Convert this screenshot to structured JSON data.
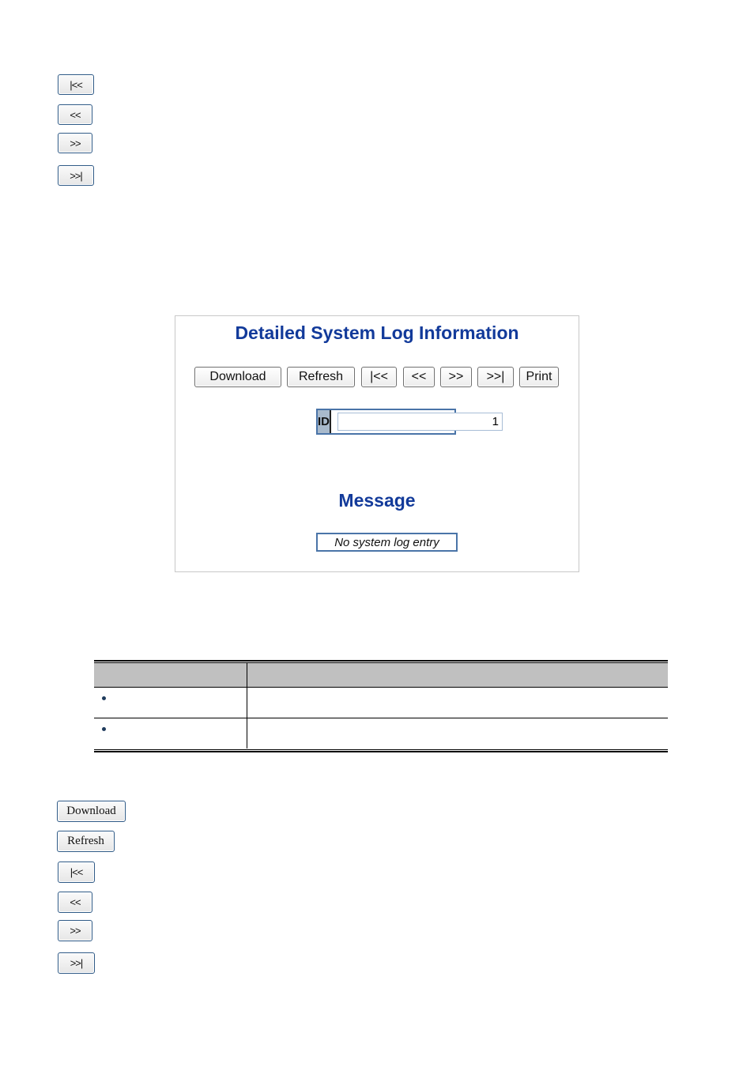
{
  "top_buttons": [
    {
      "label": "|<<",
      "name": "first-page-button"
    },
    {
      "label": "<<",
      "name": "previous-page-button"
    },
    {
      "label": ">>",
      "name": "next-page-button"
    },
    {
      "label": ">>|",
      "name": "last-page-button"
    }
  ],
  "panel": {
    "title": "Detailed System Log Information",
    "buttons": {
      "download": "Download",
      "refresh": "Refresh",
      "first": "|<<",
      "previous": "<<",
      "next": ">>",
      "last": ">>|",
      "print": "Print"
    },
    "id_label": "ID",
    "id_value": "1",
    "message_title": "Message",
    "message_text": "No system log entry"
  },
  "table": {
    "headers": [
      "",
      ""
    ],
    "rows": [
      {
        "bullet": "•",
        "object": "",
        "description": ""
      },
      {
        "bullet": "•",
        "object": "",
        "description": ""
      }
    ]
  },
  "bottom_buttons": [
    {
      "label": "Download",
      "name": "download-button"
    },
    {
      "label": "Refresh",
      "name": "refresh-button"
    },
    {
      "label": "|<<",
      "name": "first-page-button"
    },
    {
      "label": "<<",
      "name": "previous-page-button"
    },
    {
      "label": ">>",
      "name": "next-page-button"
    },
    {
      "label": ">>|",
      "name": "last-page-button"
    }
  ]
}
